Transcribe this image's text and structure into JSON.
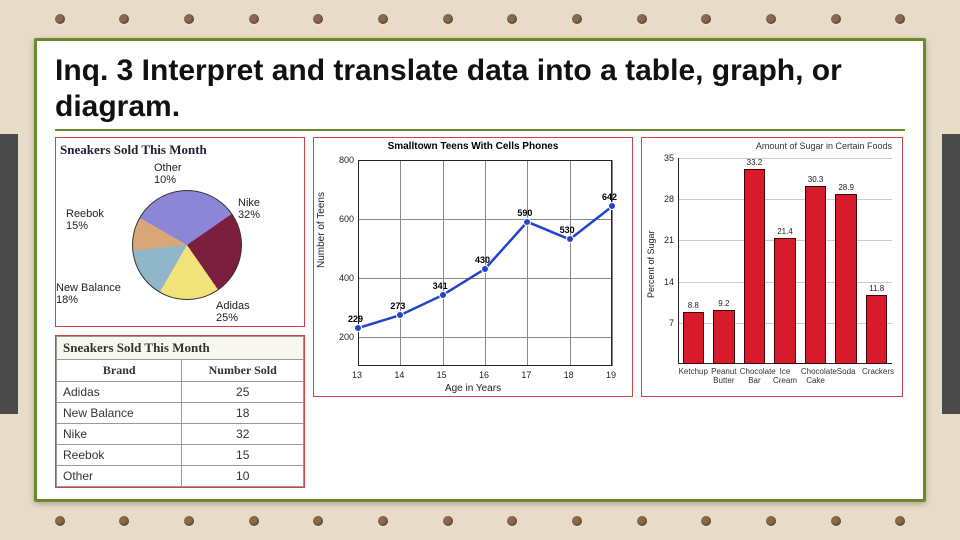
{
  "title": "Inq. 3 Interpret and translate data into a table, graph, or diagram.",
  "chart_data": [
    {
      "type": "pie",
      "title": "Sneakers Sold This Month",
      "categories": [
        "Nike",
        "Adidas",
        "New Balance",
        "Reebok",
        "Other"
      ],
      "values": [
        32,
        25,
        18,
        15,
        10
      ],
      "unit": "%",
      "colors": [
        "#8b86d8",
        "#7c1f3e",
        "#f2e27a",
        "#8fb7c9",
        "#d8a778"
      ]
    },
    {
      "type": "table",
      "title": "Sneakers Sold This Month",
      "columns": [
        "Brand",
        "Number Sold"
      ],
      "rows": [
        [
          "Adidas",
          25
        ],
        [
          "New Balance",
          18
        ],
        [
          "Nike",
          32
        ],
        [
          "Reebok",
          15
        ],
        [
          "Other",
          10
        ]
      ]
    },
    {
      "type": "line",
      "title": "Smalltown Teens With Cells Phones",
      "xlabel": "Age in Years",
      "ylabel": "Number of Teens",
      "x": [
        13,
        14,
        15,
        16,
        17,
        18,
        19
      ],
      "values": [
        229,
        273,
        341,
        430,
        590,
        530,
        642
      ],
      "xticks": [
        13,
        14,
        15,
        16,
        17,
        18,
        19
      ],
      "yticks": [
        200,
        400,
        600,
        800
      ],
      "ylim": [
        100,
        800
      ],
      "grid": true,
      "series_color": "#2244cc"
    },
    {
      "type": "bar",
      "title": "Amount of Sugar in Certain Foods",
      "xlabel": "",
      "ylabel": "Percent of Sugar",
      "categories": [
        "Ketchup",
        "Peanut Butter",
        "Chocolate Bar",
        "Ice Cream",
        "Chocolate Cake",
        "Soda",
        "Crackers"
      ],
      "values": [
        8.8,
        9.2,
        33.2,
        21.4,
        30.3,
        28.9,
        11.8
      ],
      "yticks": [
        7,
        14,
        21,
        28,
        35
      ],
      "ylim": [
        0,
        35
      ],
      "bar_color": "#d81b2c"
    }
  ]
}
